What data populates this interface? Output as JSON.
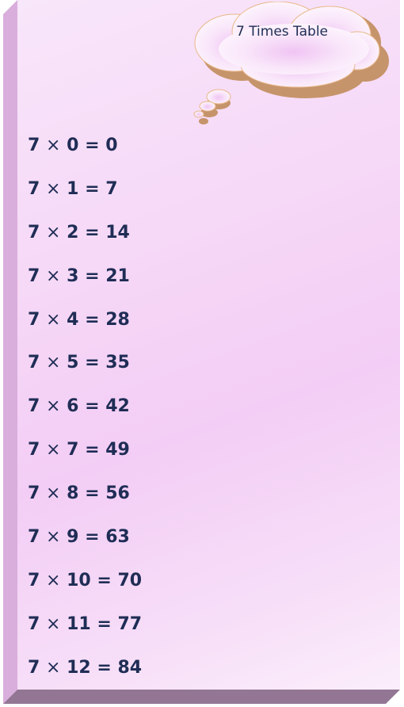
{
  "title": "7 Times Table",
  "colors": {
    "text": "#1f2d55",
    "front_face": "#f6d8f7",
    "side_face": "#d9aedc",
    "bottom_face": "#937694",
    "cloud_shadow": "#c6946b",
    "cloud_outline": "#e8b88a"
  },
  "rows": [
    {
      "a": "7",
      "op": "×",
      "b": "0",
      "eq": "=",
      "result": "0"
    },
    {
      "a": "7",
      "op": "×",
      "b": "1",
      "eq": "=",
      "result": "7"
    },
    {
      "a": "7",
      "op": "×",
      "b": "2",
      "eq": "=",
      "result": "14"
    },
    {
      "a": "7",
      "op": "×",
      "b": "3",
      "eq": "=",
      "result": "21"
    },
    {
      "a": "7",
      "op": "×",
      "b": "4",
      "eq": "=",
      "result": "28"
    },
    {
      "a": "7",
      "op": "×",
      "b": "5",
      "eq": "=",
      "result": "35"
    },
    {
      "a": "7",
      "op": "×",
      "b": "6",
      "eq": "=",
      "result": "42"
    },
    {
      "a": "7",
      "op": "×",
      "b": "7",
      "eq": "=",
      "result": "49"
    },
    {
      "a": "7",
      "op": "×",
      "b": "8",
      "eq": "=",
      "result": "56"
    },
    {
      "a": "7",
      "op": "×",
      "b": "9",
      "eq": "=",
      "result": "63"
    },
    {
      "a": "7",
      "op": "×",
      "b": "10",
      "eq": "=",
      "result": "70"
    },
    {
      "a": "7",
      "op": "×",
      "b": "11",
      "eq": "=",
      "result": "77"
    },
    {
      "a": "7",
      "op": "×",
      "b": "12",
      "eq": "=",
      "result": "84"
    }
  ]
}
